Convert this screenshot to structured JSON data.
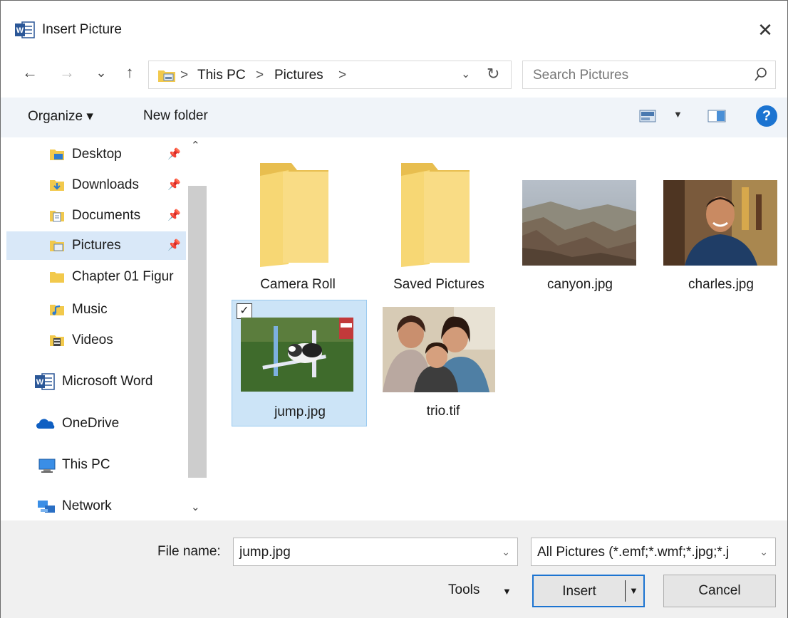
{
  "window": {
    "title": "Insert Picture",
    "close_glyph": "✕"
  },
  "nav": {
    "back": "←",
    "forward": "→",
    "recent": "⌄",
    "up": "↑",
    "crumbs": [
      "This PC",
      "Pictures"
    ],
    "separator": ">",
    "dropdown": "⌄",
    "refresh": "↻"
  },
  "search": {
    "placeholder": "Search Pictures"
  },
  "toolbar": {
    "organize": "Organize ▾",
    "new_folder": "New folder",
    "help": "?"
  },
  "sidebar": {
    "items": [
      {
        "label": "Desktop",
        "icon": "desktop-folder-icon",
        "pinned": true
      },
      {
        "label": "Downloads",
        "icon": "downloads-folder-icon",
        "pinned": true
      },
      {
        "label": "Documents",
        "icon": "documents-folder-icon",
        "pinned": true
      },
      {
        "label": "Pictures",
        "icon": "pictures-folder-icon",
        "pinned": true,
        "selected": true
      },
      {
        "label": "Chapter 01 Figur",
        "icon": "folder-icon"
      },
      {
        "label": "Music",
        "icon": "music-folder-icon"
      },
      {
        "label": "Videos",
        "icon": "videos-folder-icon"
      },
      {
        "label": "Microsoft Word",
        "icon": "word-icon"
      },
      {
        "label": "OneDrive",
        "icon": "onedrive-icon"
      },
      {
        "label": "This PC",
        "icon": "this-pc-icon"
      },
      {
        "label": "Network",
        "icon": "network-icon"
      }
    ]
  },
  "files": [
    {
      "name": "Camera Roll",
      "kind": "folder"
    },
    {
      "name": "Saved Pictures",
      "kind": "folder"
    },
    {
      "name": "canyon.jpg",
      "kind": "image"
    },
    {
      "name": "charles.jpg",
      "kind": "image"
    },
    {
      "name": "jump.jpg",
      "kind": "image",
      "selected": true
    },
    {
      "name": "trio.tif",
      "kind": "image"
    }
  ],
  "footer": {
    "file_name_label": "File name:",
    "file_name_value": "jump.jpg",
    "filter_value": "All Pictures (*.emf;*.wmf;*.jpg;*.j",
    "tools_label": "Tools",
    "insert_label": "Insert",
    "cancel_label": "Cancel"
  },
  "colors": {
    "accent": "#1c74d1",
    "selection": "#cce4f7",
    "folder": "#f7d774"
  }
}
